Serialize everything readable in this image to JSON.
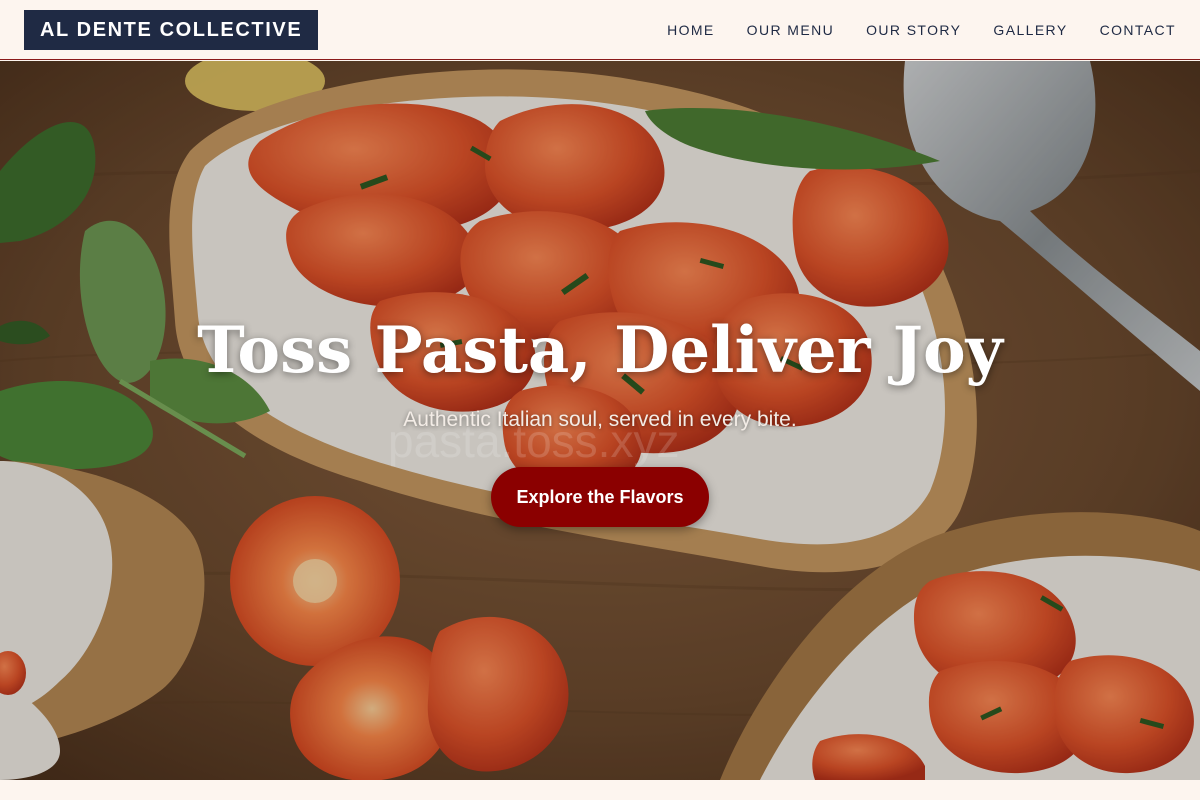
{
  "header": {
    "logo_text": "AL DENTE COLLECTIVE",
    "nav": [
      {
        "label": "HOME"
      },
      {
        "label": "OUR MENU"
      },
      {
        "label": "OUR STORY"
      },
      {
        "label": "GALLERY"
      },
      {
        "label": "CONTACT"
      }
    ]
  },
  "hero": {
    "title": "Toss Pasta, Deliver Joy",
    "subtitle": "Authentic Italian soul, served in every bite.",
    "cta_label": "Explore the Flavors",
    "watermark_text": "pasta.toss.xyz"
  },
  "colors": {
    "logo_bg": "#1f2a44",
    "accent": "#8b0000",
    "page_bg": "#fdf5ef"
  }
}
